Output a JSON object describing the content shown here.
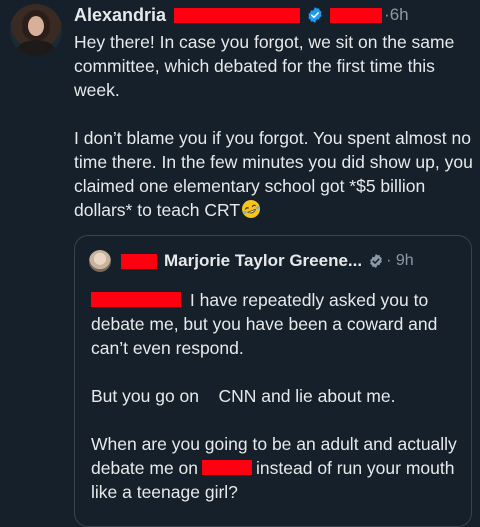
{
  "tweet": {
    "author_name": "Alexandria",
    "time_sep": "·",
    "time": "6h",
    "paragraph1": "Hey there! In case you forgot, we sit on the same committee, which debated for the first time this week.",
    "paragraph2": "I don’t blame you if you forgot. You spent almost no time there. In the few minutes you did show up, you claimed one elementary school got *$5 billion dollars* to teach CRT"
  },
  "quoted_tweet": {
    "author_name": "Marjorie Taylor Greene...",
    "time_sep": "·",
    "time": "9h",
    "line1_suffix": " I have repeatedly asked you to debate me, but you have been a coward and can’t even respond.",
    "paragraph2": "But you go on    CNN and lie about me.",
    "paragraph3_part1": "When are you going to be an adult and actually debate me on",
    "paragraph3_part2": "instead of run your mouth like a teenage girl?"
  },
  "colors": {
    "background": "#15202b",
    "text": "#e7e9ea",
    "muted": "#8b98a5",
    "redaction": "#ff0011",
    "verified_blue": "#1d9bf0",
    "border": "#38444d"
  }
}
